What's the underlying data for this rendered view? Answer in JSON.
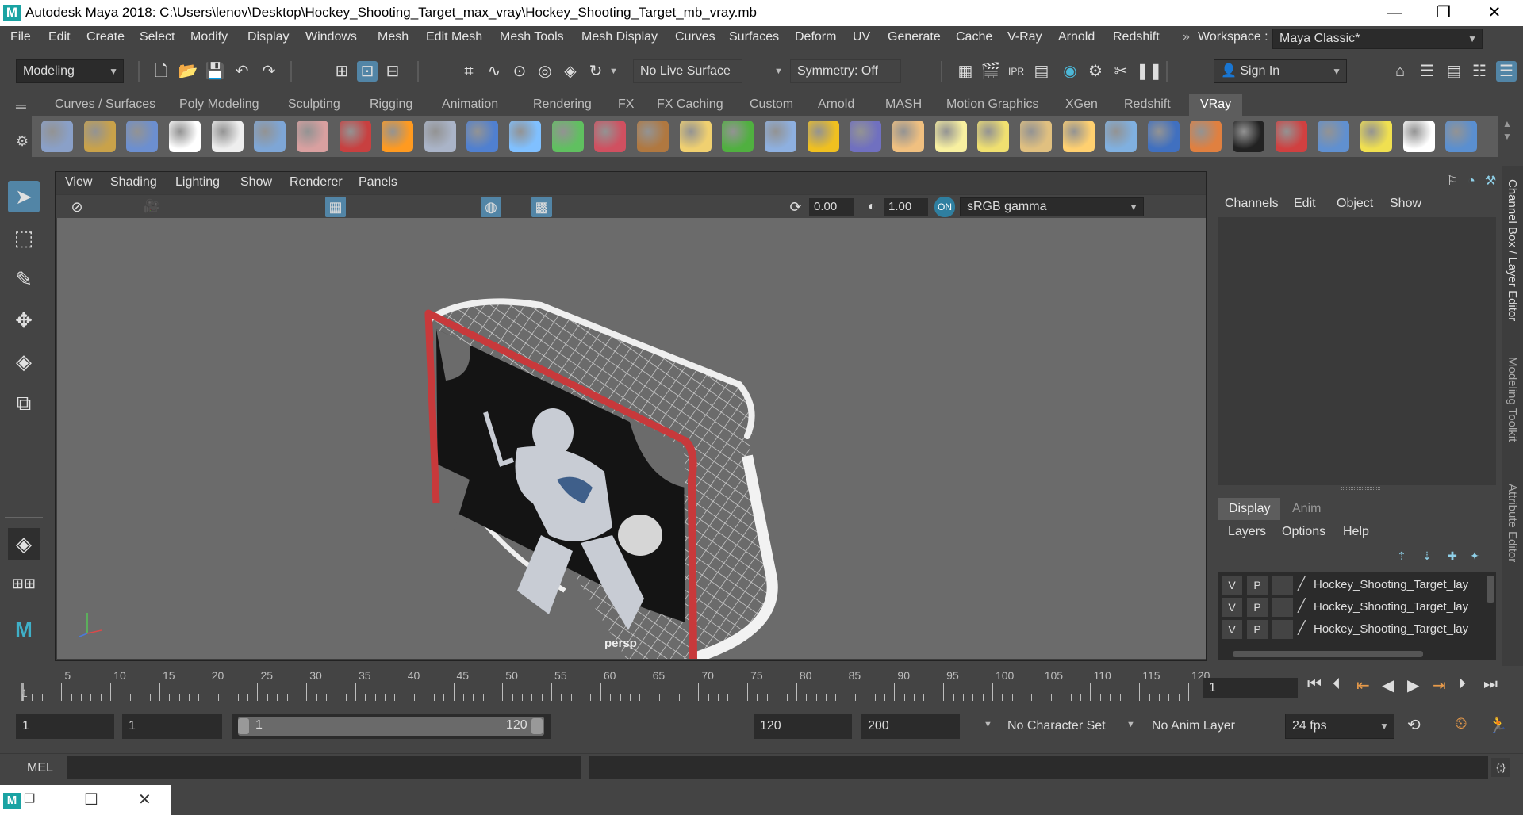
{
  "window": {
    "logo": "M",
    "title": "Autodesk Maya 2018: C:\\Users\\lenov\\Desktop\\Hockey_Shooting_Target_max_vray\\Hockey_Shooting_Target_mb_vray.mb",
    "minimize": "—",
    "restore": "❐",
    "close": "✕"
  },
  "menubar": {
    "items": [
      "File",
      "Edit",
      "Create",
      "Select",
      "Modify",
      "Display",
      "Windows",
      "Mesh",
      "Edit Mesh",
      "Mesh Tools",
      "Mesh Display",
      "Curves",
      "Surfaces",
      "Deform",
      "UV",
      "Generate",
      "Cache",
      "V-Ray",
      "Arnold",
      "Redshift"
    ],
    "workspace_label": "Workspace :",
    "workspace_value": "Maya Classic*"
  },
  "statusline": {
    "mode": "Modeling",
    "live_surface": "No Live Surface",
    "symmetry": "Symmetry: Off",
    "sign_in": "Sign In"
  },
  "shelf": {
    "tabs": [
      "Curves / Surfaces",
      "Poly Modeling",
      "Sculpting",
      "Rigging",
      "Animation",
      "Rendering",
      "FX",
      "FX Caching",
      "Custom",
      "Arnold",
      "MASH",
      "Motion Graphics",
      "XGen",
      "Redshift",
      "VRay"
    ],
    "active_tab": "VRay",
    "icon_colors": [
      "#8aa0c8",
      "#c9a24a",
      "#6c8fd0",
      "#ffffff",
      "#eeeeee",
      "#7ea6d6",
      "#d9a0a0",
      "#c84040",
      "#ff9a20",
      "#aab4c8",
      "#5080d0",
      "#80c0ff",
      "#60c060",
      "#d05060",
      "#b07840",
      "#f0d070",
      "#50b040",
      "#8eb0e0",
      "#f0c020",
      "#7070c0",
      "#f0c080",
      "#f8f0a0",
      "#f0e070",
      "#e0c080",
      "#ffd070",
      "#80b0e0",
      "#4070c0",
      "#e08040",
      "#222222",
      "#d04040",
      "#6090d0",
      "#f0e050",
      "#ffffff",
      "#5a8fd0"
    ]
  },
  "viewport": {
    "menus": [
      "View",
      "Shading",
      "Lighting",
      "Show",
      "Renderer",
      "Panels"
    ],
    "exposure": "0.00",
    "gamma": "1.00",
    "colorspace": "sRGB gamma",
    "camera_label": "persp"
  },
  "channelbox": {
    "menus": [
      "Channels",
      "Edit",
      "Object",
      "Show"
    ],
    "vertical_tab_1": "Channel Box / Layer Editor",
    "vertical_tab_2": "Modeling Toolkit",
    "vertical_tab_3": "Attribute Editor",
    "layer_tabs": [
      "Display",
      "Anim"
    ],
    "layer_menus": [
      "Layers",
      "Options",
      "Help"
    ],
    "layers": [
      {
        "v": "V",
        "p": "P",
        "name": "Hockey_Shooting_Target_lay"
      },
      {
        "v": "V",
        "p": "P",
        "name": "Hockey_Shooting_Target_lay"
      },
      {
        "v": "V",
        "p": "P",
        "name": "Hockey_Shooting_Target_lay"
      }
    ]
  },
  "timeline": {
    "ticks": [
      "5",
      "10",
      "15",
      "20",
      "25",
      "30",
      "35",
      "40",
      "45",
      "50",
      "55",
      "60",
      "65",
      "70",
      "75",
      "80",
      "85",
      "90",
      "95",
      "100",
      "105",
      "110",
      "115",
      "120"
    ],
    "start_marker": "1",
    "current_frame": "1"
  },
  "range": {
    "start": "1",
    "playback_start": "1",
    "slider_start": "1",
    "slider_end": "120",
    "playback_end": "120",
    "end": "200",
    "character_set": "No Character Set",
    "anim_layer": "No Anim Layer",
    "fps": "24 fps"
  },
  "commandline": {
    "label": "MEL"
  },
  "colors": {
    "accent": "#5285a6",
    "goal_frame": "#c8393b",
    "panel": "#444444",
    "viewport_bg": "#6b6b6b"
  }
}
